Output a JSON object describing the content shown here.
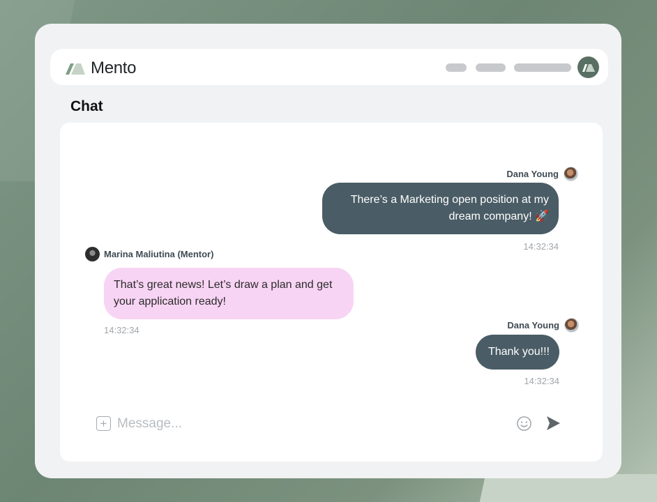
{
  "app": {
    "name": "Mento",
    "logo_icon": "mento-logo-icon"
  },
  "page": {
    "title": "Chat"
  },
  "messages": [
    {
      "sender": "Dana Young",
      "direction": "outgoing",
      "text": "There’s a Marketing open position at my dream company! 🚀",
      "time": "14:32:34"
    },
    {
      "sender": "Marina Maliutina (Mentor)",
      "direction": "incoming",
      "text": "That’s great news! Let’s draw a plan and get your application ready!",
      "time": "14:32:34"
    },
    {
      "sender": "Dana Young",
      "direction": "outgoing",
      "text": "Thank you!!!",
      "time": "14:32:34"
    }
  ],
  "composer": {
    "placeholder": "Message...",
    "add_icon": "plus-square-icon",
    "emoji_icon": "smiley-icon",
    "send_icon": "send-icon"
  },
  "colors": {
    "outgoing_bubble": "#4a5c65",
    "incoming_bubble": "#f8d4f4",
    "brand": "#7f9887"
  }
}
